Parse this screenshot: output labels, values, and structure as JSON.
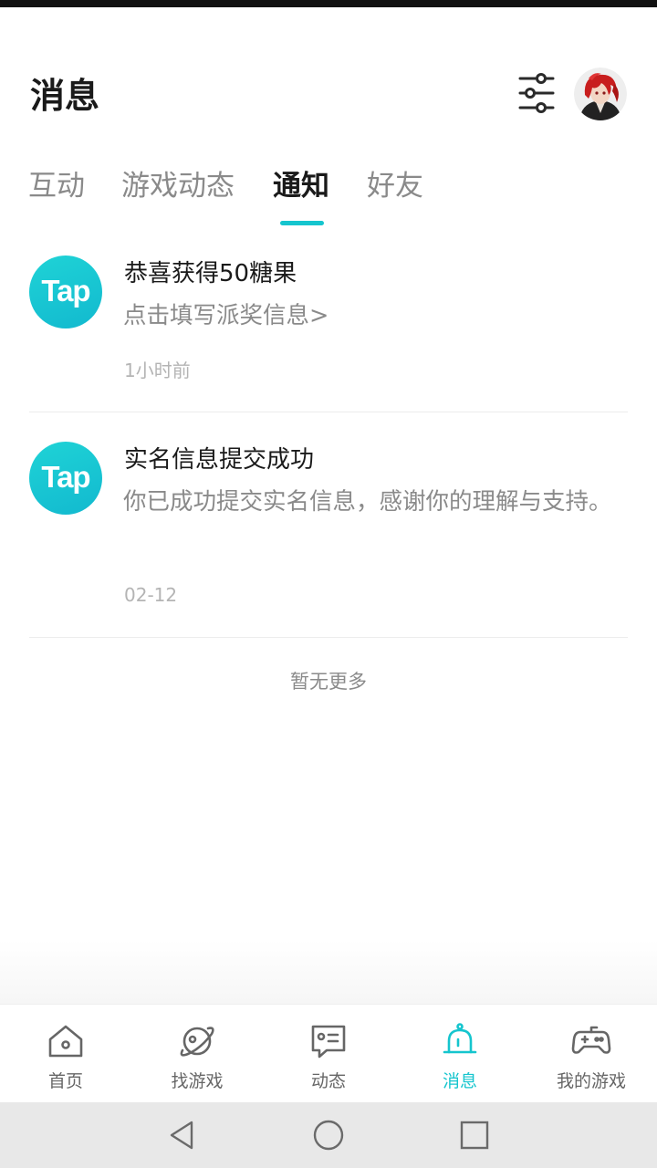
{
  "header": {
    "title": "消息",
    "filter_icon": "sliders-icon",
    "avatar_icon": "user-avatar"
  },
  "tabs": [
    {
      "label": "互动",
      "active": false
    },
    {
      "label": "游戏动态",
      "active": false
    },
    {
      "label": "通知",
      "active": true
    },
    {
      "label": "好友",
      "active": false
    }
  ],
  "notifications": [
    {
      "logo_text": "Tap",
      "title": "恭喜获得50糖果",
      "body": "点击填写派奖信息>",
      "time": "1小时前"
    },
    {
      "logo_text": "Tap",
      "title": "实名信息提交成功",
      "body": "你已成功提交实名信息，感谢你的理解与支持。",
      "time": "02-12"
    }
  ],
  "list_footer": "暂无更多",
  "bottom_nav": [
    {
      "label": "首页",
      "icon": "home-icon",
      "active": false
    },
    {
      "label": "找游戏",
      "icon": "planet-icon",
      "active": false
    },
    {
      "label": "动态",
      "icon": "chat-icon",
      "active": false
    },
    {
      "label": "消息",
      "icon": "bell-icon",
      "active": true
    },
    {
      "label": "我的游戏",
      "icon": "gamepad-icon",
      "active": false
    }
  ],
  "colors": {
    "accent": "#15c5ce",
    "text_primary": "#1a1a1a",
    "text_secondary": "#8a8a8a"
  }
}
